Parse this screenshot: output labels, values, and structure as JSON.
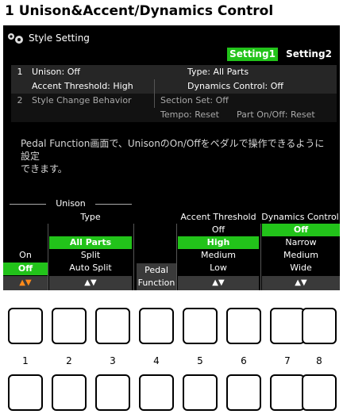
{
  "heading": "1 Unison&Accent/Dynamics Control",
  "window": {
    "title": "Style Setting",
    "icon": "style-setting-icon",
    "tabs": [
      {
        "label": "Setting1",
        "active": true
      },
      {
        "label": "Setting2",
        "active": false
      }
    ]
  },
  "info": {
    "row1": {
      "num": "1",
      "left": "Unison: Off",
      "right": "Type: All Parts"
    },
    "row2": {
      "left": "Accent Threshold: High",
      "right": "Dynamics Control: Off"
    },
    "row3": {
      "num": "2",
      "left": "Style Change Behavior",
      "mid": "Section Set: Off"
    },
    "row4": {
      "mid": "Tempo: Reset",
      "right": "Part On/Off: Reset"
    }
  },
  "description": {
    "line1": "Pedal Function画面で、UnisonのOn/Offをペダルで操作できるように設定",
    "line2": "できます。"
  },
  "controls": {
    "unison_title": "Unison",
    "type_title": "Type",
    "accent_title": "Accent Threshold",
    "dynamics_title": "Dynamics Control",
    "unison_values": [
      "On",
      "Off"
    ],
    "unison_selected": "Off",
    "type_values": [
      "All Parts",
      "Split",
      "Auto Split"
    ],
    "type_selected": "All Parts",
    "pedal_line1": "Pedal",
    "pedal_line2": "Function",
    "accent_values": [
      "Off",
      "High",
      "Medium",
      "Low"
    ],
    "accent_selected": "High",
    "dynamics_values": [
      "Off",
      "Narrow",
      "Medium",
      "Wide"
    ],
    "dynamics_selected": "Off",
    "arrow": "▲▼"
  },
  "buttons": {
    "labels": [
      "1",
      "2",
      "3",
      "4",
      "5",
      "6",
      "7",
      "8"
    ]
  },
  "colors": {
    "accent_green": "#22c31a",
    "arrow_orange": "#ff8a1a"
  }
}
